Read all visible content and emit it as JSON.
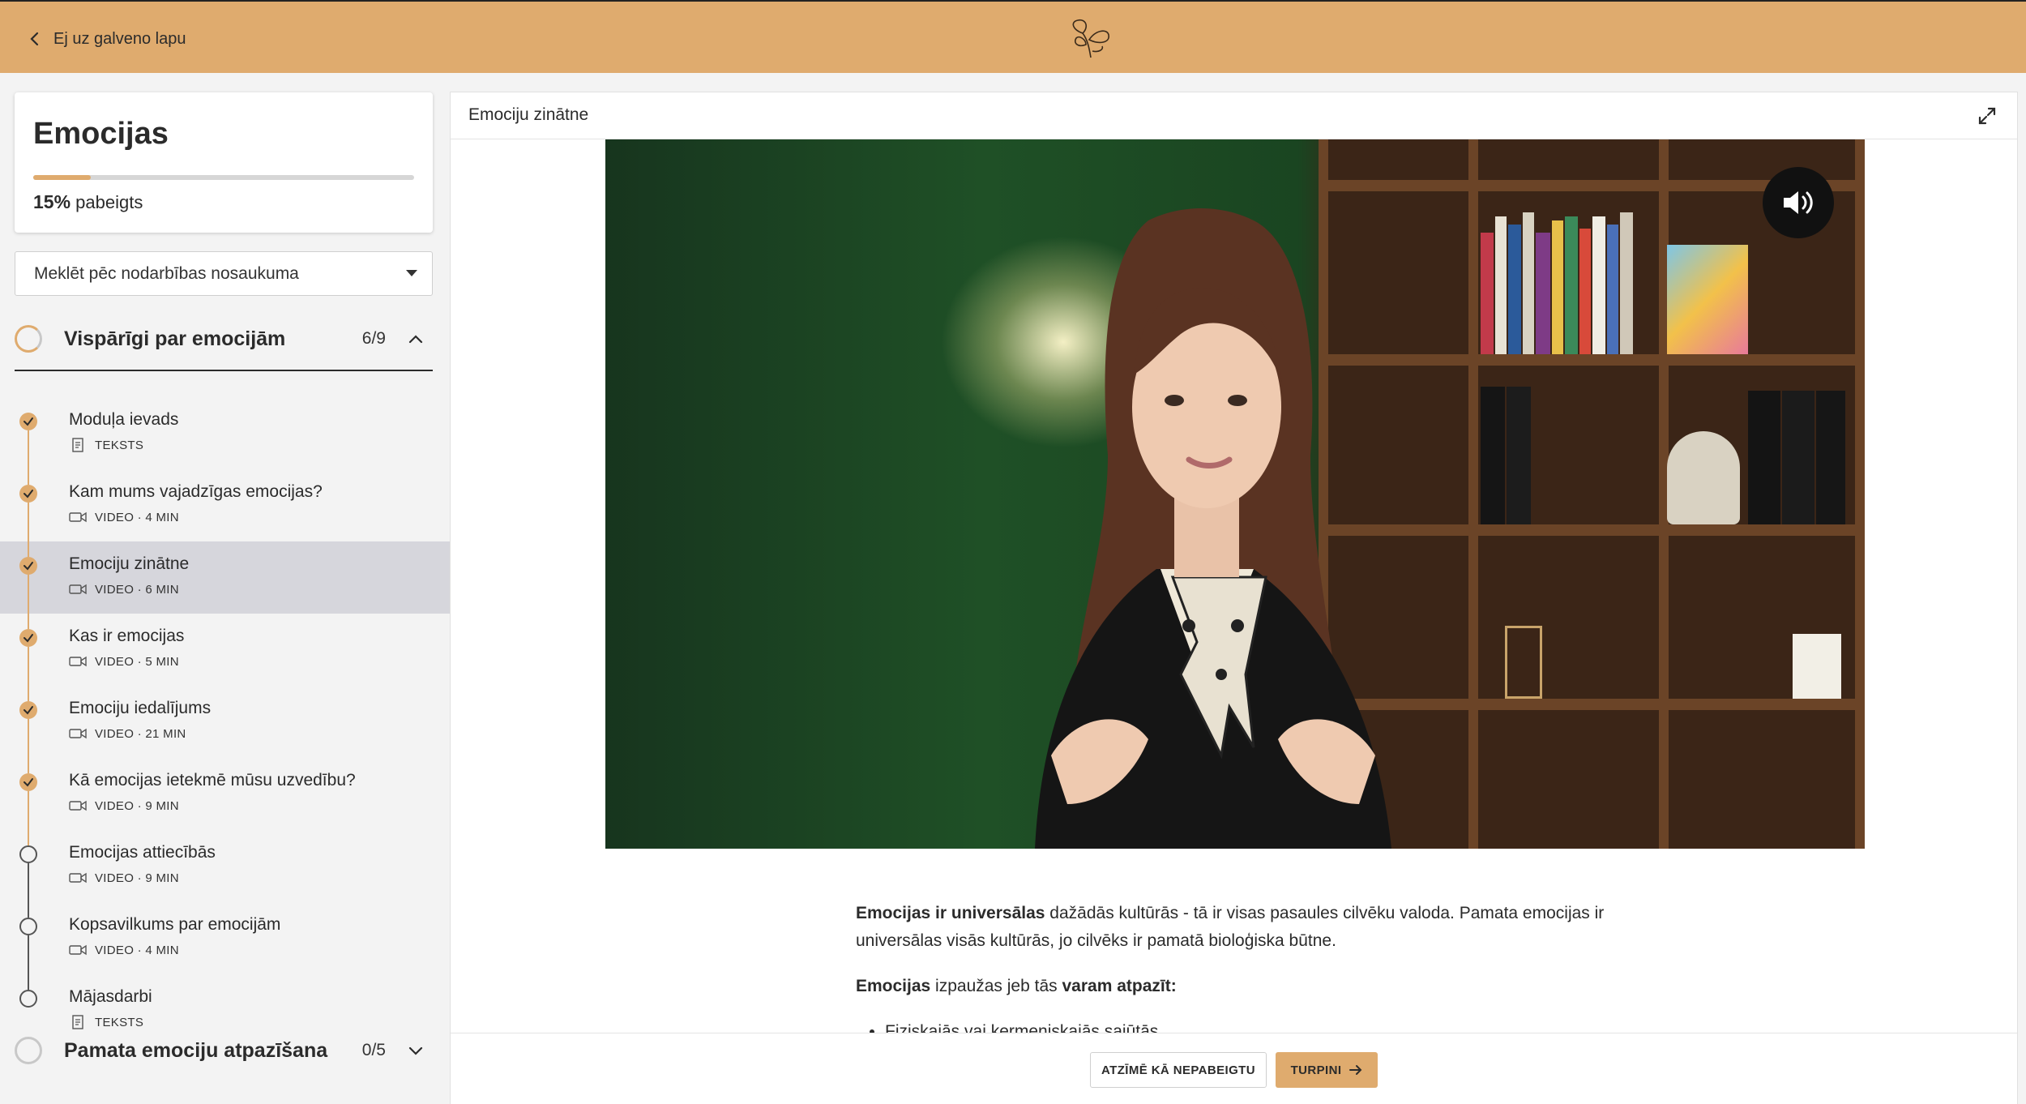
{
  "topbar": {
    "back_label": "Ej uz galveno lapu",
    "logo_icon": "seed-sprout-logo"
  },
  "course": {
    "title": "Emocijas",
    "progress_percent": 15,
    "progress_label": "15%",
    "progress_suffix": "pabeigts"
  },
  "search": {
    "label": "Meklēt pēc nodarbības nosaukuma"
  },
  "modules": [
    {
      "title": "Vispārīgi par emocijām",
      "count": "6/9",
      "expanded": true,
      "lessons": [
        {
          "title": "Moduļa ievads",
          "meta": "TEKSTS",
          "type_icon": "document-icon",
          "done": true,
          "active": false
        },
        {
          "title": "Kam mums vajadzīgas emocijas?",
          "meta": "VIDEO · 4 MIN",
          "type_icon": "video-icon",
          "done": true,
          "active": false
        },
        {
          "title": "Emociju zinātne",
          "meta": "VIDEO · 6 MIN",
          "type_icon": "video-icon",
          "done": true,
          "active": true
        },
        {
          "title": "Kas ir emocijas",
          "meta": "VIDEO · 5 MIN",
          "type_icon": "video-icon",
          "done": true,
          "active": false
        },
        {
          "title": "Emociju iedalījums",
          "meta": "VIDEO · 21 MIN",
          "type_icon": "video-icon",
          "done": true,
          "active": false
        },
        {
          "title": "Kā emocijas ietekmē mūsu uzvedību?",
          "meta": "VIDEO · 9 MIN",
          "type_icon": "video-icon",
          "done": true,
          "active": false
        },
        {
          "title": "Emocijas attiecībās",
          "meta": "VIDEO · 9 MIN",
          "type_icon": "video-icon",
          "done": false,
          "active": false
        },
        {
          "title": "Kopsavilkums par emocijām",
          "meta": "VIDEO · 4 MIN",
          "type_icon": "video-icon",
          "done": false,
          "active": false
        },
        {
          "title": "Mājasdarbi",
          "meta": "TEKSTS",
          "type_icon": "document-icon",
          "done": false,
          "active": false
        }
      ]
    },
    {
      "title": "Pamata emociju atpazīšana",
      "count": "0/5",
      "expanded": false,
      "lessons": []
    }
  ],
  "content": {
    "title": "Emociju zinātne",
    "article": {
      "p1_bold": "Emocijas ir universālas",
      "p1_rest": " dažādās kultūrās - tā ir visas pasaules cilvēku valoda. Pamata emocijas ir universālas visās kultūrās, jo cilvēks ir pamatā bioloģiska būtne.",
      "p2_bold": "Emocijas",
      "p2_mid": " izpaužas jeb tās ",
      "p2_bold2": "varam atpazīt:",
      "list_item_1": "Fiziskajās vai ķermeniskajās sajūtās"
    }
  },
  "footer": {
    "mark_incomplete_label": "ATZĪMĒ KĀ NEPABEIGTU",
    "continue_label": "TURPINI"
  },
  "colors": {
    "accent": "#dfab6e",
    "active_row": "#d6d6dc"
  }
}
